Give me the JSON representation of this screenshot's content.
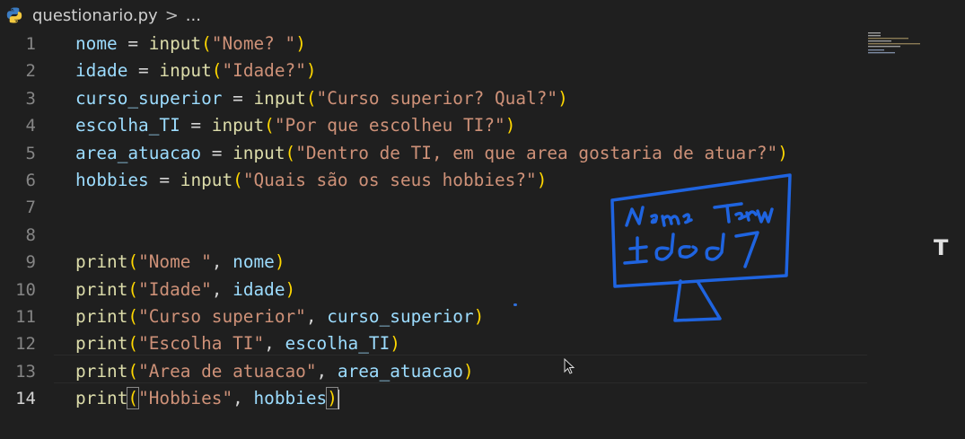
{
  "breadcrumb": {
    "file": "questionario.py",
    "sep": ">",
    "more": "..."
  },
  "editor": {
    "lines": [
      {
        "n": "1",
        "tokens": [
          [
            "var",
            "nome"
          ],
          [
            "punc",
            " = "
          ],
          [
            "fn",
            "input"
          ],
          [
            "paren",
            "("
          ],
          [
            "str",
            "\"Nome? \""
          ],
          [
            "paren",
            ")"
          ]
        ]
      },
      {
        "n": "2",
        "tokens": [
          [
            "var",
            "idade"
          ],
          [
            "punc",
            " = "
          ],
          [
            "fn",
            "input"
          ],
          [
            "paren",
            "("
          ],
          [
            "str",
            "\"Idade?\""
          ],
          [
            "paren",
            ")"
          ]
        ]
      },
      {
        "n": "3",
        "tokens": [
          [
            "var",
            "curso_superior"
          ],
          [
            "punc",
            " = "
          ],
          [
            "fn",
            "input"
          ],
          [
            "paren",
            "("
          ],
          [
            "str",
            "\"Curso superior? Qual?\""
          ],
          [
            "paren",
            ")"
          ]
        ]
      },
      {
        "n": "4",
        "tokens": [
          [
            "var",
            "escolha_TI"
          ],
          [
            "punc",
            " = "
          ],
          [
            "fn",
            "input"
          ],
          [
            "paren",
            "("
          ],
          [
            "str",
            "\"Por que escolheu TI?\""
          ],
          [
            "paren",
            ")"
          ]
        ]
      },
      {
        "n": "5",
        "tokens": [
          [
            "var",
            "area_atuacao"
          ],
          [
            "punc",
            " = "
          ],
          [
            "fn",
            "input"
          ],
          [
            "paren",
            "("
          ],
          [
            "str",
            "\"Dentro de TI, em que area gostaria de atuar?\""
          ],
          [
            "paren",
            ")"
          ]
        ]
      },
      {
        "n": "6",
        "tokens": [
          [
            "var",
            "hobbies"
          ],
          [
            "punc",
            " = "
          ],
          [
            "fn",
            "input"
          ],
          [
            "paren",
            "("
          ],
          [
            "str",
            "\"Quais são os seus hobbies?\""
          ],
          [
            "paren",
            ")"
          ]
        ]
      },
      {
        "n": "7",
        "tokens": []
      },
      {
        "n": "8",
        "tokens": []
      },
      {
        "n": "9",
        "tokens": [
          [
            "fn",
            "print"
          ],
          [
            "paren",
            "("
          ],
          [
            "str",
            "\"Nome \""
          ],
          [
            "punc",
            ", "
          ],
          [
            "var",
            "nome"
          ],
          [
            "paren",
            ")"
          ]
        ]
      },
      {
        "n": "10",
        "tokens": [
          [
            "fn",
            "print"
          ],
          [
            "paren",
            "("
          ],
          [
            "str",
            "\"Idade\""
          ],
          [
            "punc",
            ", "
          ],
          [
            "var",
            "idade"
          ],
          [
            "paren",
            ")"
          ]
        ]
      },
      {
        "n": "11",
        "tokens": [
          [
            "fn",
            "print"
          ],
          [
            "paren",
            "("
          ],
          [
            "str",
            "\"Curso superior\""
          ],
          [
            "punc",
            ", "
          ],
          [
            "var",
            "curso_superior"
          ],
          [
            "paren",
            ")"
          ]
        ]
      },
      {
        "n": "12",
        "tokens": [
          [
            "fn",
            "print"
          ],
          [
            "paren",
            "("
          ],
          [
            "str",
            "\"Escolha TI\""
          ],
          [
            "punc",
            ", "
          ],
          [
            "var",
            "escolha_TI"
          ],
          [
            "paren",
            ")"
          ]
        ]
      },
      {
        "n": "13",
        "tokens": [
          [
            "fn",
            "print"
          ],
          [
            "paren",
            "("
          ],
          [
            "str",
            "\"Area de atuacao\""
          ],
          [
            "punc",
            ", "
          ],
          [
            "var",
            "area_atuacao"
          ],
          [
            "paren",
            ")"
          ]
        ]
      },
      {
        "n": "14",
        "tokens": [
          [
            "fn",
            "print"
          ],
          [
            "paren",
            "("
          ],
          [
            "str",
            "\"Hobbies\""
          ],
          [
            "punc",
            ", "
          ],
          [
            "var",
            "hobbies"
          ],
          [
            "paren",
            ")"
          ]
        ],
        "active": true
      }
    ]
  },
  "icons": {
    "file_type": "python-icon",
    "side": "text-tool-icon"
  },
  "side_tool_label": "T",
  "annotation_color": "#1f64e0"
}
